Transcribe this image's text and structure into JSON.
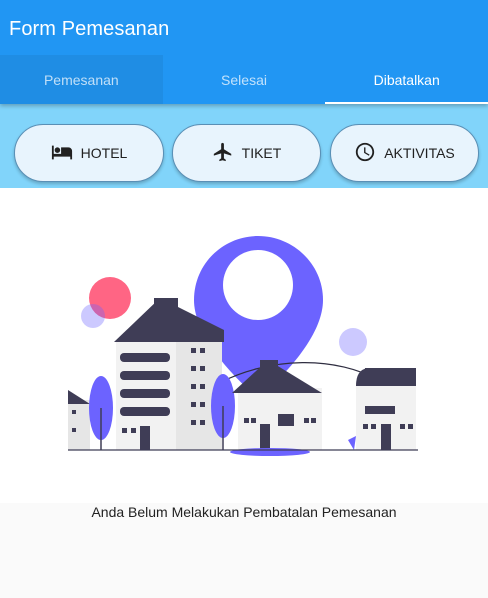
{
  "appbar": {
    "title": "Form Pemesanan"
  },
  "tabs": [
    {
      "label": "Pemesanan"
    },
    {
      "label": "Selesai"
    },
    {
      "label": "Dibatalkan"
    }
  ],
  "categories": [
    {
      "label": "HOTEL",
      "icon": "hotel-bed-icon"
    },
    {
      "label": "TIKET",
      "icon": "airplane-icon"
    },
    {
      "label": "AKTIVITAS",
      "icon": "clock-icon"
    }
  ],
  "empty_state": {
    "message": "Anda Belum Melakukan Pembatalan Pemesanan"
  },
  "colors": {
    "primary": "#2196f3",
    "category_bar": "#81d4fa",
    "accent_pin": "#6c63ff",
    "accent_pink": "#ff6584"
  }
}
